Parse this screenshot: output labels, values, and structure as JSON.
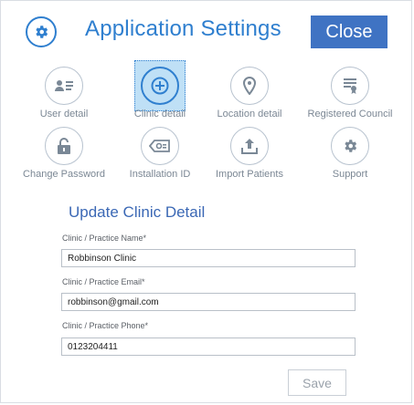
{
  "header": {
    "title": "Application Settings",
    "close_label": "Close",
    "icon": "gear-icon"
  },
  "nav_items": [
    {
      "label": "User detail",
      "icon": "user-card-icon",
      "selected": false
    },
    {
      "label": "Clinic detail",
      "icon": "plus-circle-icon",
      "selected": true
    },
    {
      "label": "Location detail",
      "icon": "location-pin-icon",
      "selected": false
    },
    {
      "label": "Registered Council",
      "icon": "certificate-icon",
      "selected": false
    },
    {
      "label": "Change Password",
      "icon": "unlock-icon",
      "selected": false
    },
    {
      "label": "Installation ID",
      "icon": "id-tag-icon",
      "selected": false
    },
    {
      "label": "Import Patients",
      "icon": "upload-icon",
      "selected": false
    },
    {
      "label": "Support",
      "icon": "gear-icon",
      "selected": false
    }
  ],
  "form": {
    "title": "Update Clinic Detail",
    "name_label": "Clinic / Practice Name*",
    "name_value": "Robbinson Clinic",
    "email_label": "Clinic / Practice Email*",
    "email_value": "robbinson@gmail.com",
    "phone_label": "Clinic / Practice Phone*",
    "phone_value": "0123204411",
    "save_label": "Save"
  },
  "colors": {
    "accent": "#2f7fcf",
    "close_bg": "#3f73c3",
    "icon_stroke": "#7a8896",
    "selected_bg": "#bfe0f6"
  }
}
